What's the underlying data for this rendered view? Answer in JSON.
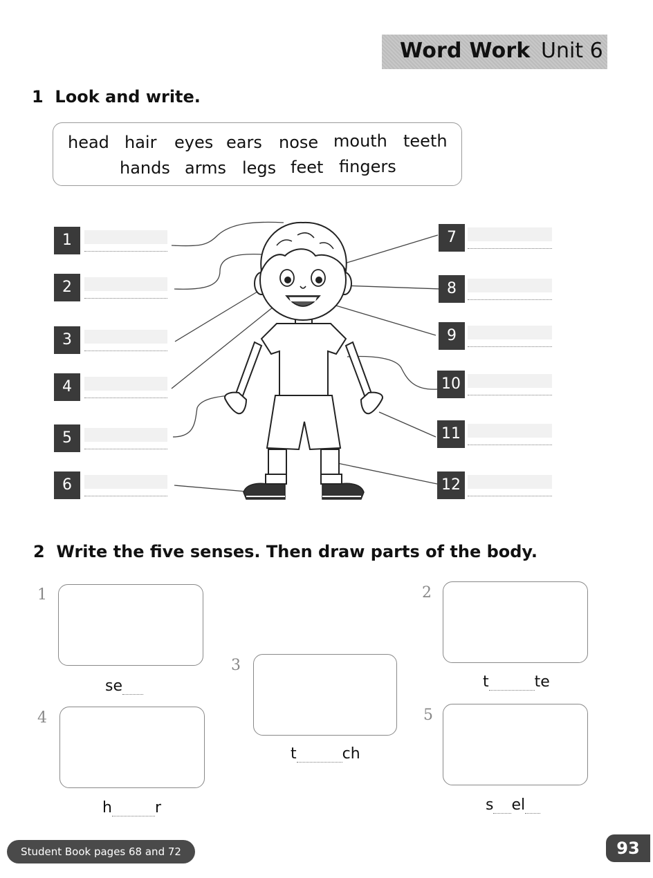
{
  "header": {
    "title": "Word Work",
    "unit": "Unit 6"
  },
  "exercise1": {
    "number": "1",
    "instruction": "Look and write.",
    "word_bank_row1": [
      "head",
      "hair",
      "eyes",
      "ears",
      "nose",
      "mouth",
      "teeth"
    ],
    "word_bank_row2": [
      "hands",
      "arms",
      "legs",
      "feet",
      "fingers"
    ],
    "labels_left": [
      "1",
      "2",
      "3",
      "4",
      "5",
      "6"
    ],
    "labels_right": [
      "7",
      "8",
      "9",
      "10",
      "11",
      "12"
    ]
  },
  "exercise2": {
    "number": "2",
    "instruction": "Write the five senses. Then draw parts of the body.",
    "items": [
      {
        "num": "1",
        "start": "se",
        "end": ""
      },
      {
        "num": "2",
        "start": "t",
        "end": "te"
      },
      {
        "num": "3",
        "start": "t",
        "end": "ch"
      },
      {
        "num": "4",
        "start": "h",
        "end": "r"
      },
      {
        "num": "5",
        "start": "s",
        "end": "el"
      }
    ]
  },
  "footer": {
    "reference": "Student Book pages 68 and 72",
    "page_number": "93"
  }
}
